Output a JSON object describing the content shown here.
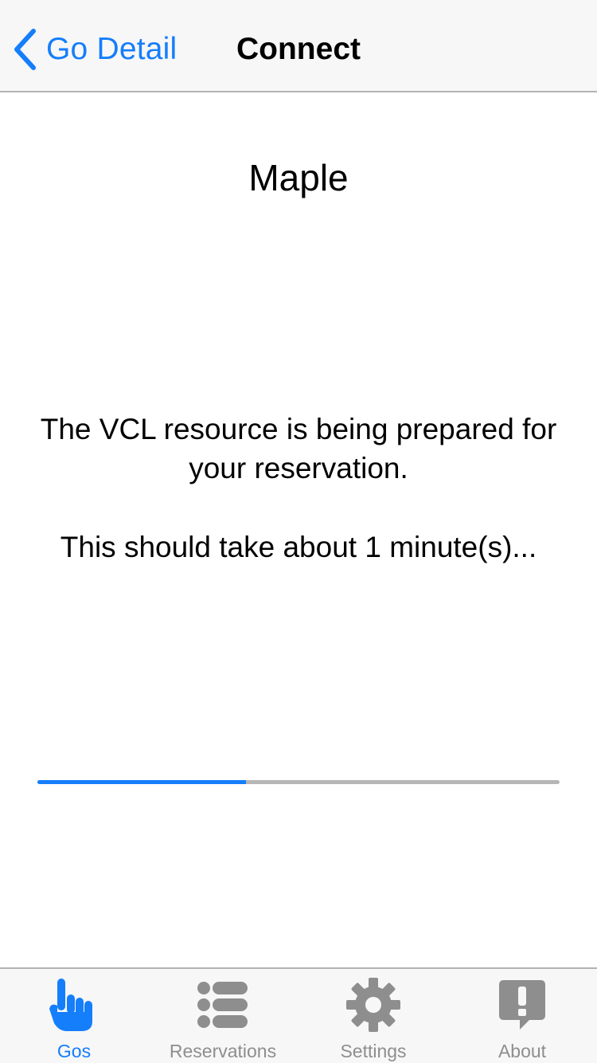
{
  "navbar": {
    "back_label": "Go Detail",
    "title": "Connect"
  },
  "content": {
    "resource_name": "Maple",
    "status_message": "The VCL resource is being prepared for your reservation.",
    "eta_message": "This should take about 1 minute(s)..."
  },
  "progress": {
    "value": 0.4
  },
  "tabs": [
    {
      "label": "Gos",
      "icon": "pointing-hand-icon",
      "active": true
    },
    {
      "label": "Reservations",
      "icon": "list-icon",
      "active": false
    },
    {
      "label": "Settings",
      "icon": "gear-icon",
      "active": false
    },
    {
      "label": "About",
      "icon": "speech-bubble-exclamation-icon",
      "active": false
    }
  ],
  "colors": {
    "accent": "#157efb",
    "inactive": "#8e8e8e",
    "bar_background": "#f7f7f7",
    "progress_track": "#b6b6b6"
  }
}
